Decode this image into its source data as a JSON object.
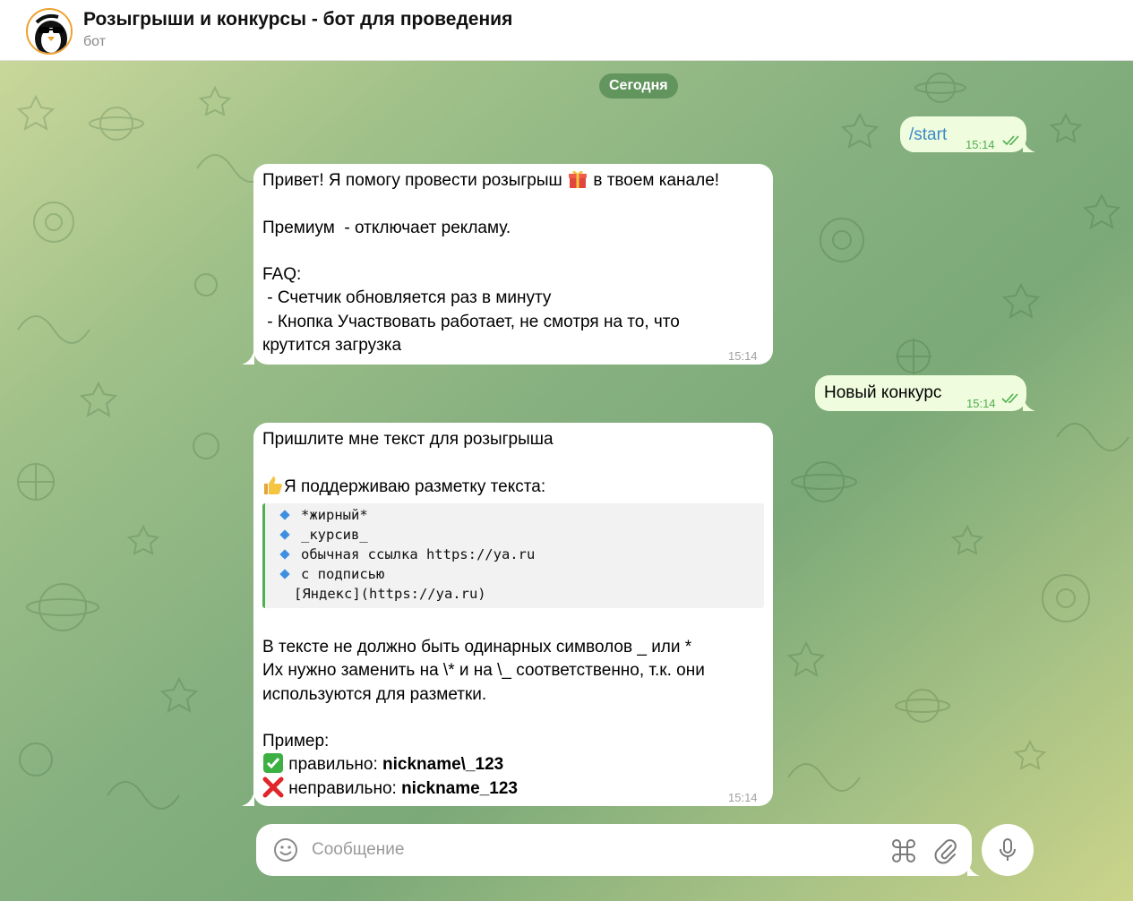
{
  "header": {
    "title": "Розыгрыши и конкурсы - бот для проведения",
    "subtitle": "бот"
  },
  "chat": {
    "date_label": "Сегодня",
    "messages": [
      {
        "direction": "out",
        "text": "/start",
        "time": "15:14",
        "status": "read"
      },
      {
        "direction": "in",
        "lines": [
          "Привет! Я помогу провести розыгрыш",
          "в твоем канале!",
          "",
          "Премиум  - отключает рекламу.",
          "",
          "FAQ:",
          " - Счетчик обновляется раз в минуту",
          " - Кнопка Участвовать работает, не смотря на то, что",
          "крутится загрузка"
        ],
        "time": "15:14"
      },
      {
        "direction": "out",
        "text": "Новый конкурс",
        "time": "15:14",
        "status": "read"
      },
      {
        "direction": "in",
        "intro": "Пришлите мне текст для розыгрыша",
        "markup_heading": "Я поддерживаю разметку текста:",
        "code_items": [
          "*жирный*",
          "_курсив_",
          "обычная ссылка https://ya.ru",
          "с подписью"
        ],
        "code_tail": "[Яндекс](https://ya.ru)",
        "body_lines": [
          "В тексте не должно быть одинарных символов _ или *",
          "Их нужно заменить на \\* и на \\_ соответственно, т.к. они",
          "используются для разметки."
        ],
        "example_title": "Пример:",
        "correct_label": "правильно:",
        "correct_value": "nickname\\_123",
        "wrong_label": "неправильно:",
        "wrong_value": "nickname_123",
        "time": "15:14"
      }
    ]
  },
  "composer": {
    "placeholder": "Сообщение"
  },
  "icons": {
    "emoji": "smiley-icon",
    "commands": "command-icon",
    "attach": "paperclip-icon",
    "mic": "microphone-icon",
    "read": "double-check-icon",
    "gift": "gift-icon",
    "thumbs_up": "thumbs-up-icon",
    "check": "check-mark-icon",
    "cross": "cross-mark-icon"
  },
  "colors": {
    "outgoing_bubble": "#effdde",
    "incoming_bubble": "#ffffff",
    "read_check": "#4fae4e",
    "link_accent": "#3a8ac4",
    "code_border": "#4fb04f"
  }
}
